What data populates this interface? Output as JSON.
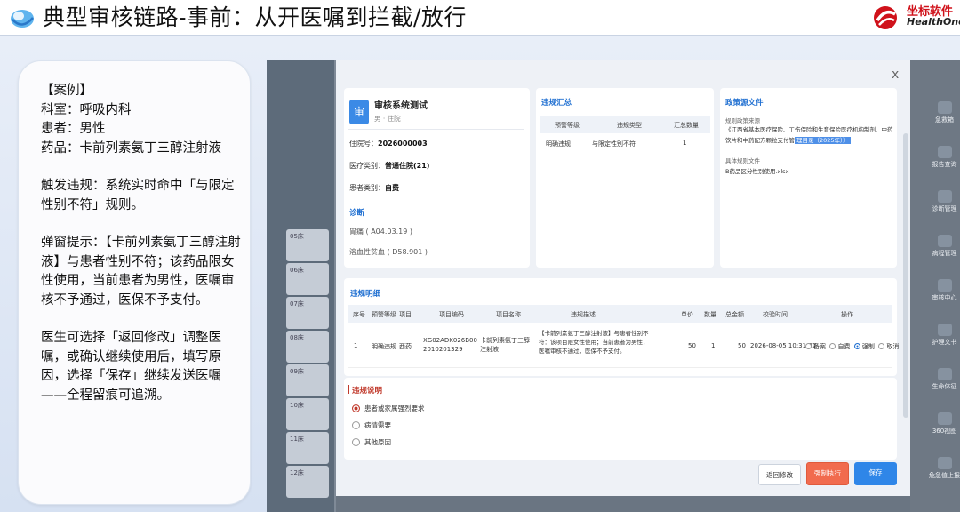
{
  "slide": {
    "title": "典型审核链路-事前：从开医嘱到拦截/放行",
    "brand_cn": "坐标软件",
    "brand_en": "HealthOne",
    "colors": {
      "accent": "#1f6fd1",
      "brand_red": "#d0121b",
      "danger": "#f16b4e",
      "primary": "#2f86e8"
    }
  },
  "case": {
    "heading": "【案例】",
    "dept": "科室：呼吸内科",
    "patient": "患者：男性",
    "drug": "药品：卡前列素氨丁三醇注射液",
    "trigger": "触发违规：系统实时命中「与限定性别不符」规则。",
    "popup": "弹窗提示：【卡前列素氨丁三醇注射液】与患者性别不符；该药品限女性使用，当前患者为男性，医嘱审核不予通过，医保不予支付。",
    "doctor": "医生可选择「返回修改」调整医嘱，或确认继续使用后，填写原因，选择「保存」继续发送医嘱",
    "trace": "——全程留痕可追溯。"
  },
  "background": {
    "left_items": [
      "05床",
      "06床",
      "07床",
      "08床",
      "09床",
      "10床",
      "11床",
      "12床"
    ],
    "right_items": [
      "急救箱",
      "报告查询",
      "诊断管理",
      "病程管理",
      "审核中心",
      "护理文书",
      "生命体征",
      "360视图",
      "危急值上报"
    ]
  },
  "modal": {
    "close": "x",
    "patient": {
      "avatar_char": "审",
      "name": "审核系统测试",
      "sub": "男 · 住院",
      "inpatient_no_label": "住院号：",
      "inpatient_no": "2026000003",
      "med_type_label": "医疗类别：",
      "med_type": "普通住院(21)",
      "pat_type_label": "患者类别：",
      "pat_type": "自费",
      "diag_title": "诊断",
      "diagnoses": [
        "胃痛 ( A04.03.19 )",
        "溶血性贫血 ( D58.901 )"
      ]
    },
    "summary": {
      "title": "违规汇总",
      "headers": [
        "预警等级",
        "违规类型",
        "汇总数量"
      ],
      "row": [
        "明确违规",
        "与限定性别不符",
        "1"
      ]
    },
    "policy": {
      "title": "政策源文件",
      "source_label": "规则政策来源",
      "source_text": "《江西省基本医疗保险、工伤保险和生育保险医疗机构制剂、中药饮片和中药配方颗粒支付管",
      "source_highlight": "理目录（2025年）》",
      "file_label": "具体规则文件",
      "file": "B药品区分性别使用.xlsx"
    },
    "detail": {
      "title": "违规明细",
      "headers": [
        "序号",
        "预警等级",
        "项目...",
        "项目编码",
        "项目名称",
        "违规描述",
        "单价",
        "数量",
        "总金额",
        "校验时间",
        "操作"
      ],
      "row": {
        "no": "1",
        "level": "明确违规",
        "category": "西药",
        "code": "XG02ADK026B002010201329",
        "name": "卡前列素氨丁三醇注射液",
        "desc": "【卡前列素氨丁三醇注射液】与患者性别不符：该项目限女性使用；当前患者为男性，医嘱审核不通过，医保不予支付。",
        "price": "50",
        "qty": "1",
        "total": "50",
        "time": "2026-08-05 10:31:01",
        "ops": [
          "备案",
          "自费",
          "强制",
          "取消"
        ],
        "op_selected": "强制"
      }
    },
    "reason": {
      "title": "违规说明",
      "options": [
        "患者或家属强烈要求",
        "病情需要",
        "其他原因"
      ],
      "selected": "患者或家属强烈要求"
    },
    "buttons": {
      "back": "返回修改",
      "force": "强制执行",
      "save": "保存"
    }
  }
}
